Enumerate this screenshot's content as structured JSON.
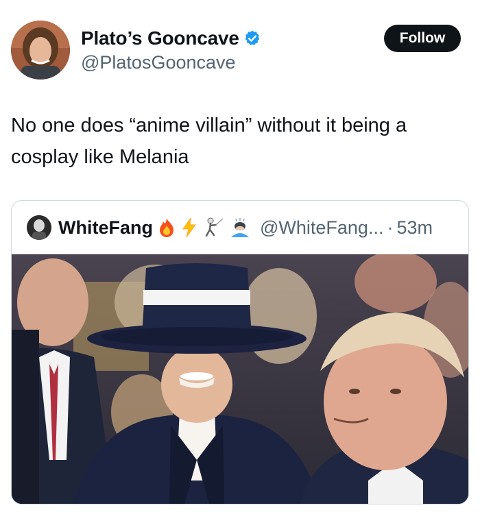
{
  "post": {
    "author": {
      "display_name": "Plato’s Gooncave",
      "handle": "@PlatosGooncave",
      "verified_icon": "verified-badge-icon",
      "verified_color": "#1d9bf0"
    },
    "follow_label": "Follow",
    "text": "No one does “anime villain” without it being a cosplay like Melania"
  },
  "quote": {
    "author": {
      "display_name": "WhiteFang",
      "emoji_icons": [
        "fire-icon",
        "lightning-icon",
        "fencer-icon",
        "person-bowing-icon"
      ]
    },
    "handle": "@WhiteFang...",
    "separator": "·",
    "time": "53m"
  },
  "colors": {
    "text_primary": "#0f1419",
    "text_secondary": "#536471",
    "button_bg": "#0f1419",
    "border": "#cfd9de"
  }
}
